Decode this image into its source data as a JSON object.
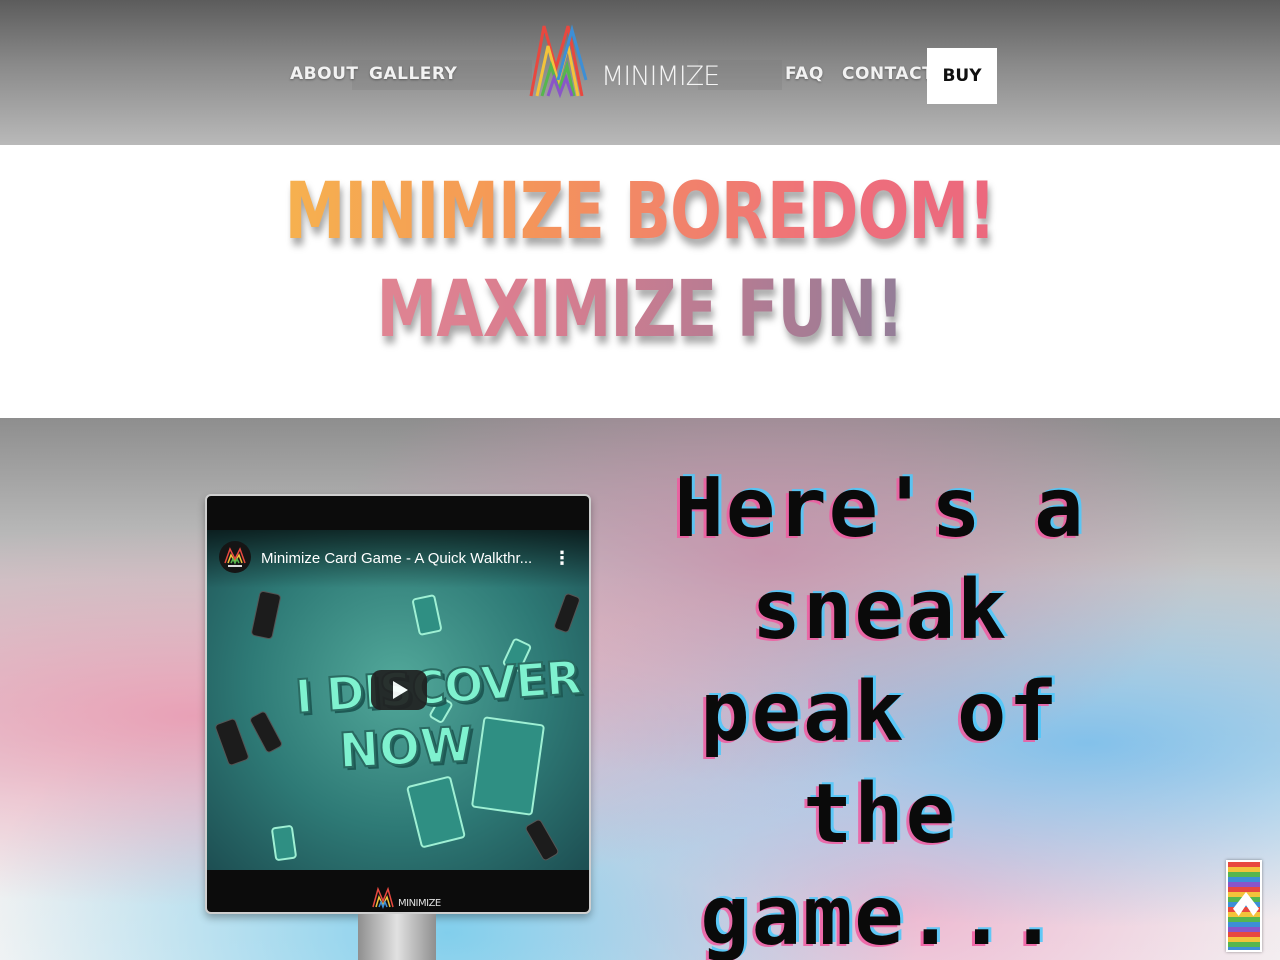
{
  "header": {
    "nav_left": [
      "ABOUT",
      "GALLERY"
    ],
    "nav_right": [
      "FAQ",
      "CONTACT"
    ],
    "buy_label": "BUY",
    "logo_text": "MINIMIZE"
  },
  "hero": {
    "line1": "MINIMIZE BOREDOM!",
    "line2": "MAXIMIZE FUN!"
  },
  "video": {
    "title": "Minimize Card Game - A Quick Walkthr...",
    "thumbnail_text_1": "I DISCOVER",
    "thumbnail_text_2": "NOW",
    "monitor_brand": "MINIMIZE"
  },
  "sneak_text": [
    "Here's a",
    "sneak",
    "peak of",
    "the",
    "game..."
  ],
  "colors": {
    "brand_red": "#e8483f",
    "brand_yellow": "#f3c33b",
    "brand_green": "#56b64e",
    "brand_blue": "#3d8fd6",
    "brand_purple": "#8a55c9"
  }
}
